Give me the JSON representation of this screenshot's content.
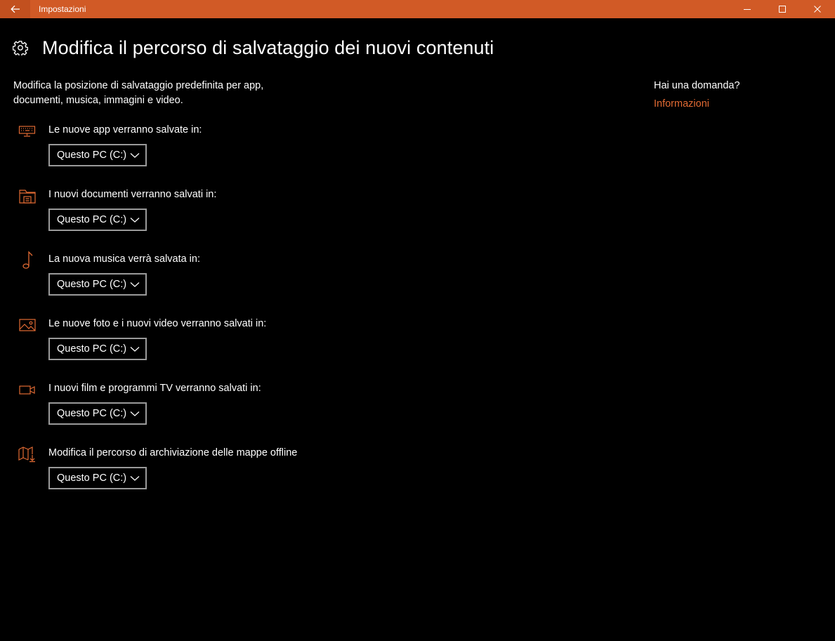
{
  "window": {
    "title": "Impostazioni",
    "accent": "#d15a26",
    "link_color": "#e16a33"
  },
  "header": {
    "title": "Modifica il percorso di salvataggio dei nuovi contenuti",
    "icon": "gear-icon"
  },
  "description": "Modifica la posizione di salvataggio predefinita per app, documenti, musica, immagini e video.",
  "settings": [
    {
      "label": "Le nuove app verranno salvate in:",
      "value": "Questo PC (C:)",
      "icon": "monitor-keyboard-icon"
    },
    {
      "label": "I nuovi documenti verranno salvati in:",
      "value": "Questo PC (C:)",
      "icon": "documents-folder-icon"
    },
    {
      "label": "La nuova musica verrà salvata in:",
      "value": "Questo PC (C:)",
      "icon": "music-note-icon"
    },
    {
      "label": "Le nuove foto e i nuovi video verranno salvati in:",
      "value": "Questo PC (C:)",
      "icon": "picture-icon"
    },
    {
      "label": "I nuovi film e programmi TV verranno salvati in:",
      "value": "Questo PC (C:)",
      "icon": "video-camera-icon"
    },
    {
      "label": "Modifica il percorso di archiviazione delle mappe offline",
      "value": "Questo PC (C:)",
      "icon": "map-download-icon"
    }
  ],
  "sidebar": {
    "question": "Hai una domanda?",
    "link": "Informazioni"
  }
}
